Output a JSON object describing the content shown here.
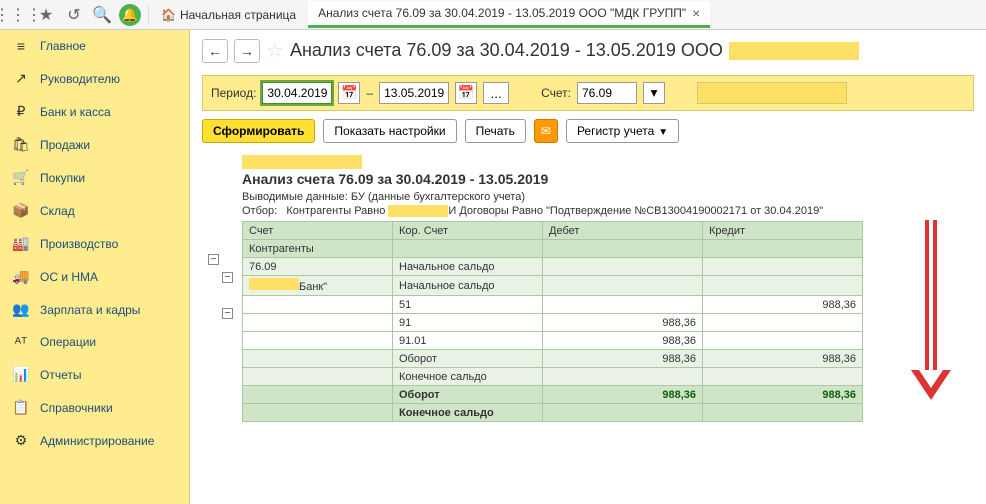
{
  "toolbar": {
    "home_label": "Начальная страница",
    "tab_label": "Анализ счета 76.09 за 30.04.2019 - 13.05.2019 ООО \"МДК ГРУПП\""
  },
  "sidebar": {
    "items": [
      {
        "icon": "≡",
        "label": "Главное"
      },
      {
        "icon": "↗",
        "label": "Руководителю"
      },
      {
        "icon": "₽",
        "label": "Банк и касса"
      },
      {
        "icon": "🛍",
        "label": "Продажи"
      },
      {
        "icon": "🛒",
        "label": "Покупки"
      },
      {
        "icon": "📦",
        "label": "Склад"
      },
      {
        "icon": "🏭",
        "label": "Производство"
      },
      {
        "icon": "🚚",
        "label": "ОС и НМА"
      },
      {
        "icon": "👥",
        "label": "Зарплата и кадры"
      },
      {
        "icon": "ᴬᵀ",
        "label": "Операции"
      },
      {
        "icon": "📊",
        "label": "Отчеты"
      },
      {
        "icon": "📋",
        "label": "Справочники"
      },
      {
        "icon": "⚙",
        "label": "Администрирование"
      }
    ]
  },
  "title": "Анализ счета 76.09 за 30.04.2019 - 13.05.2019 ООО",
  "params": {
    "period_label": "Период:",
    "date_from": "30.04.2019",
    "dash": "–",
    "date_to": "13.05.2019",
    "account_label": "Счет:",
    "account": "76.09"
  },
  "buttons": {
    "generate": "Сформировать",
    "settings": "Показать настройки",
    "print": "Печать",
    "register": "Регистр учета"
  },
  "report": {
    "title": "Анализ счета 76.09 за 30.04.2019 - 13.05.2019",
    "meta_label": "Выводимые данные:",
    "meta_value": "БУ (данные бухгалтерского учета)",
    "filter_label": "Отбор:",
    "filter_v1": "Контрагенты Равно",
    "filter_v2": "И Договоры Равно \"Подтверждение №СВ13004190002171 от 30.04.2019\"",
    "headers": {
      "acct": "Счет",
      "cor": "Кор. Счет",
      "deb": "Дебет",
      "cre": "Кредит",
      "contr": "Контрагенты"
    },
    "rows": [
      {
        "acct": "76.09",
        "cor": "Начальное сальдо",
        "deb": "",
        "cre": ""
      },
      {
        "acct": "Банк\"",
        "cor": "Начальное сальдо",
        "deb": "",
        "cre": ""
      },
      {
        "acct": "",
        "cor": "51",
        "deb": "",
        "cre": "988,36"
      },
      {
        "acct": "",
        "cor": "91",
        "deb": "988,36",
        "cre": ""
      },
      {
        "acct": "",
        "cor": "91.01",
        "deb": "988,36",
        "cre": ""
      },
      {
        "acct": "",
        "cor": "Оборот",
        "deb": "988,36",
        "cre": "988,36"
      },
      {
        "acct": "",
        "cor": "Конечное сальдо",
        "deb": "",
        "cre": ""
      }
    ],
    "summary": [
      {
        "cor": "Оборот",
        "deb": "988,36",
        "cre": "988,36"
      },
      {
        "cor": "Конечное сальдо",
        "deb": "",
        "cre": ""
      }
    ]
  }
}
